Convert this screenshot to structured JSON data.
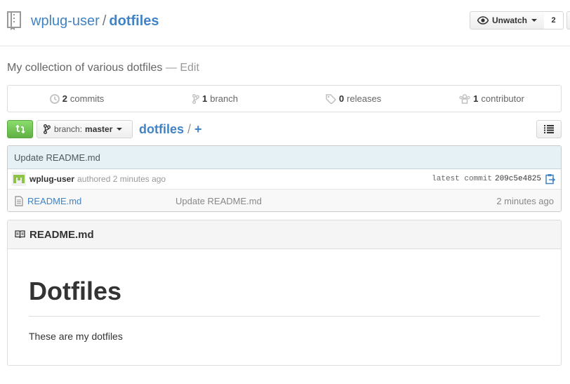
{
  "repo": {
    "owner": "wplug-user",
    "separator": "/",
    "name": "dotfiles",
    "description": "My collection of various dotfiles",
    "description_edit": "— Edit"
  },
  "watch": {
    "label": "Unwatch",
    "count": "2",
    "icon": "eye-icon"
  },
  "stats": {
    "commits": {
      "count": "2",
      "label": "commits",
      "icon": "history-icon"
    },
    "branches": {
      "count": "1",
      "label": "branch",
      "icon": "branch-icon"
    },
    "releases": {
      "count": "0",
      "label": "releases",
      "icon": "tag-icon"
    },
    "contributors": {
      "count": "1",
      "label": "contributor",
      "icon": "organization-icon"
    }
  },
  "toolbar": {
    "branch_label": "branch:",
    "branch_name": "master",
    "breadcrumb_root": "dotfiles",
    "breadcrumb_sep": "/",
    "breadcrumb_add": "+"
  },
  "commit": {
    "message": "Update README.md",
    "author": "wplug-user",
    "authored_text": "authored 2 minutes ago",
    "latest_label": "latest commit",
    "sha": "209c5e4825"
  },
  "files": [
    {
      "name": "README.md",
      "message": "Update README.md",
      "age": "2 minutes ago"
    }
  ],
  "readme": {
    "filename": "README.md",
    "heading": "Dotfiles",
    "paragraph": "These are my dotfiles"
  },
  "colors": {
    "link": "#4183c4",
    "compare_green": "#60b044",
    "commit_bar": "#e6f1f6"
  }
}
